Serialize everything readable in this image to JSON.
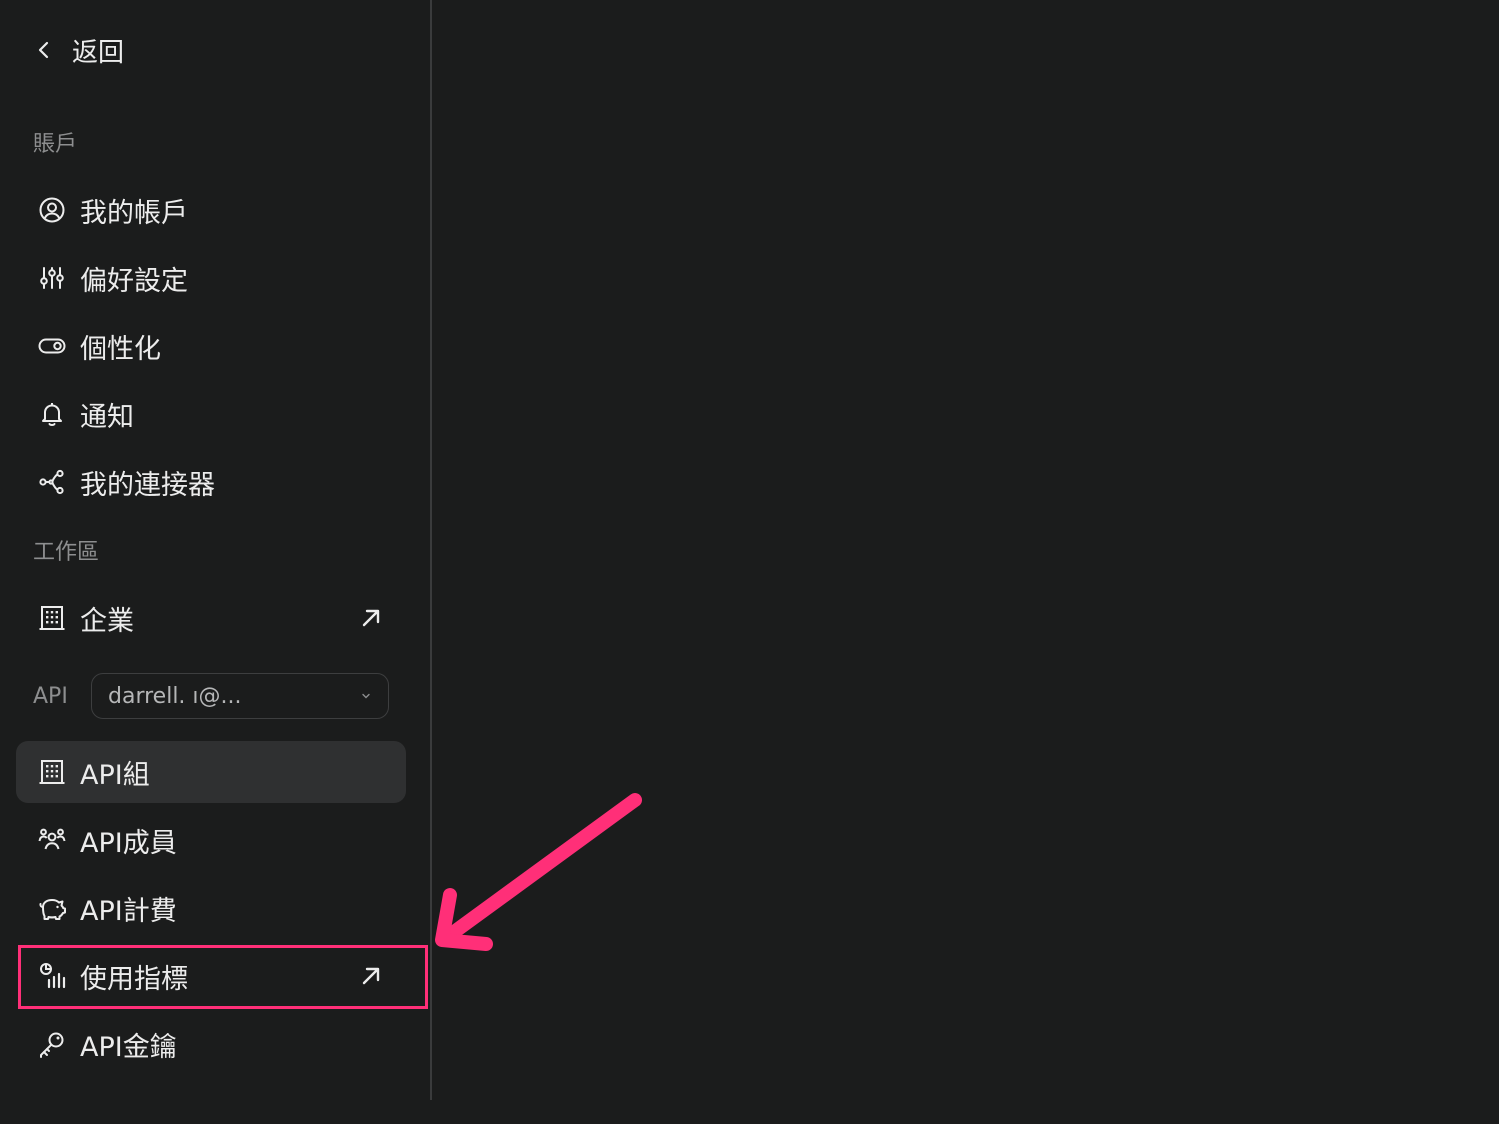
{
  "back": {
    "label": "返回"
  },
  "sections": {
    "account": "賬戶",
    "workspace": "工作區",
    "api": "API"
  },
  "account_items": [
    {
      "label": "我的帳戶",
      "icon": "user-circle-icon"
    },
    {
      "label": "偏好設定",
      "icon": "sliders-icon"
    },
    {
      "label": "個性化",
      "icon": "toggle-icon"
    },
    {
      "label": "通知",
      "icon": "bell-icon"
    },
    {
      "label": "我的連接器",
      "icon": "connector-icon"
    }
  ],
  "workspace_items": [
    {
      "label": "企業",
      "icon": "building-icon",
      "external": true
    }
  ],
  "api_selector": {
    "value": "darrell.      ı@..."
  },
  "api_items": [
    {
      "label": "API組",
      "icon": "building-icon",
      "active": true
    },
    {
      "label": "API成員",
      "icon": "users-icon"
    },
    {
      "label": "API計費",
      "icon": "piggy-bank-icon"
    },
    {
      "label": "使用指標",
      "icon": "metrics-icon",
      "external": true,
      "highlighted": true
    },
    {
      "label": "API金鑰",
      "icon": "key-icon"
    }
  ],
  "colors": {
    "background": "#1b1c1c",
    "active_item": "#2f3031",
    "annotation": "#ff2f78",
    "muted_text": "#8d8e8f"
  }
}
